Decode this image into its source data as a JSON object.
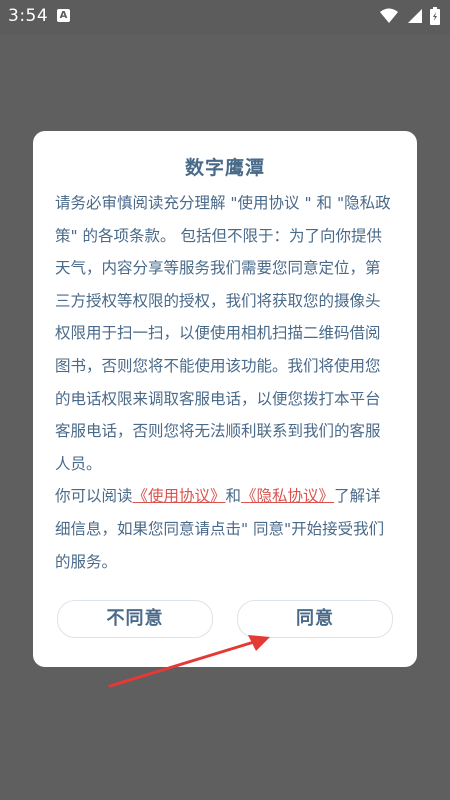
{
  "status_bar": {
    "time": "3:54",
    "notification_icon": "A",
    "icons": [
      "wifi-icon",
      "cellular-signal-icon",
      "battery-icon"
    ]
  },
  "dialog": {
    "title": "数字鹰潭",
    "paragraph1": "请务必审慎阅读充分理解 \"使用协议 \" 和 \"隐私政策\" 的各项条款。 包括但不限于：为了向你提供天气，内容分享等服务我们需要您同意定位，第三方授权等权限的授权，我们将获取您的摄像头权限用于扫一扫，以便使用相机扫描二维码借阅图书，否则您将不能使用该功能。我们将使用您的电话权限来调取客服电话，以便您拨打本平台客服电话，否则您将无法顺利联系到我们的客服人员。",
    "paragraph2_prefix": "你可以阅读",
    "link_terms": "《使用协议》",
    "paragraph2_and": "和",
    "link_privacy": "《隐私协议》",
    "paragraph2_suffix": "了解详细信息，如果您同意请点击\" 同意\"开始接受我们的服务。",
    "disagree_label": "不同意",
    "agree_label": "同意"
  },
  "colors": {
    "overlay": "#5f5f5f",
    "text": "#4a6a8a",
    "link": "#d9534f",
    "arrow": "#e53935"
  }
}
